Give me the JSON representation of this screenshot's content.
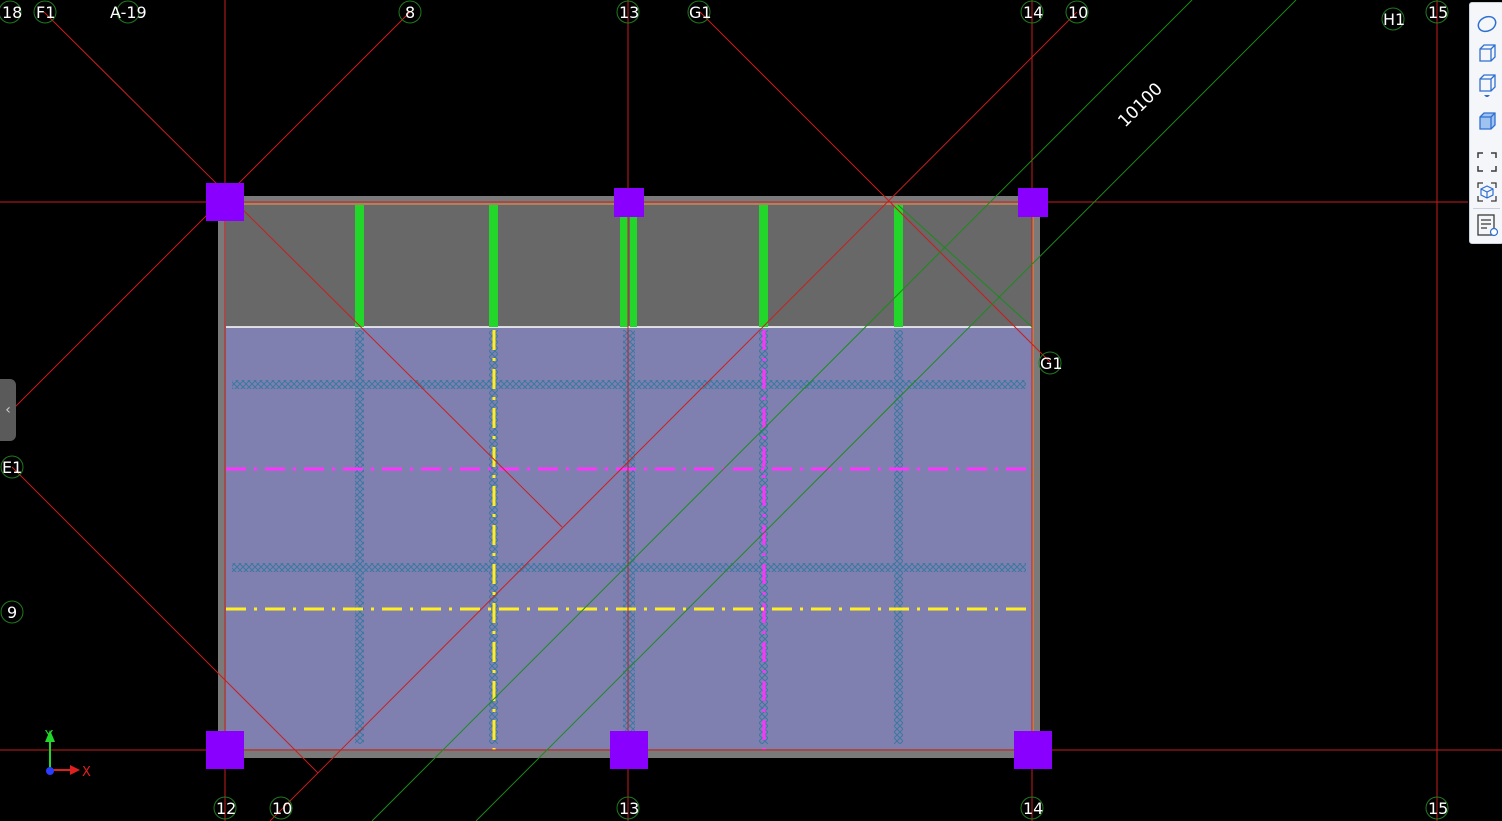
{
  "grid_axes": {
    "top": [
      "18",
      "F1",
      "A-19",
      "8",
      "13",
      "G1",
      "14",
      "10",
      "H1",
      "15"
    ],
    "bottom": [
      "12",
      "10",
      "13",
      "14",
      "15"
    ],
    "right_side": [
      "G1"
    ],
    "left_side": [
      "E1",
      "9"
    ]
  },
  "dimension": {
    "value": "10100"
  },
  "ucs": {
    "x_label": "X",
    "y_label": "Y"
  },
  "colors": {
    "background": "#000000",
    "grid_line": "#c81e1e",
    "slab_fill": "#8080b0",
    "wall_band": "#686868",
    "column": "#8a00ff",
    "rebar_green": "#22d62a",
    "magenta_dash": "#ff33ff",
    "yellow_dash": "#ffee22",
    "green_line": "#1c8a1c",
    "hatch": "#3a78a0"
  },
  "toolbar": {
    "icons": [
      "orbit-icon",
      "view-3d-icon",
      "view-cube-icon",
      "shaded-box-icon",
      "zoom-extents-icon",
      "iso-view-icon",
      "properties-icon"
    ]
  },
  "side_panel": {
    "arrow": "‹"
  }
}
